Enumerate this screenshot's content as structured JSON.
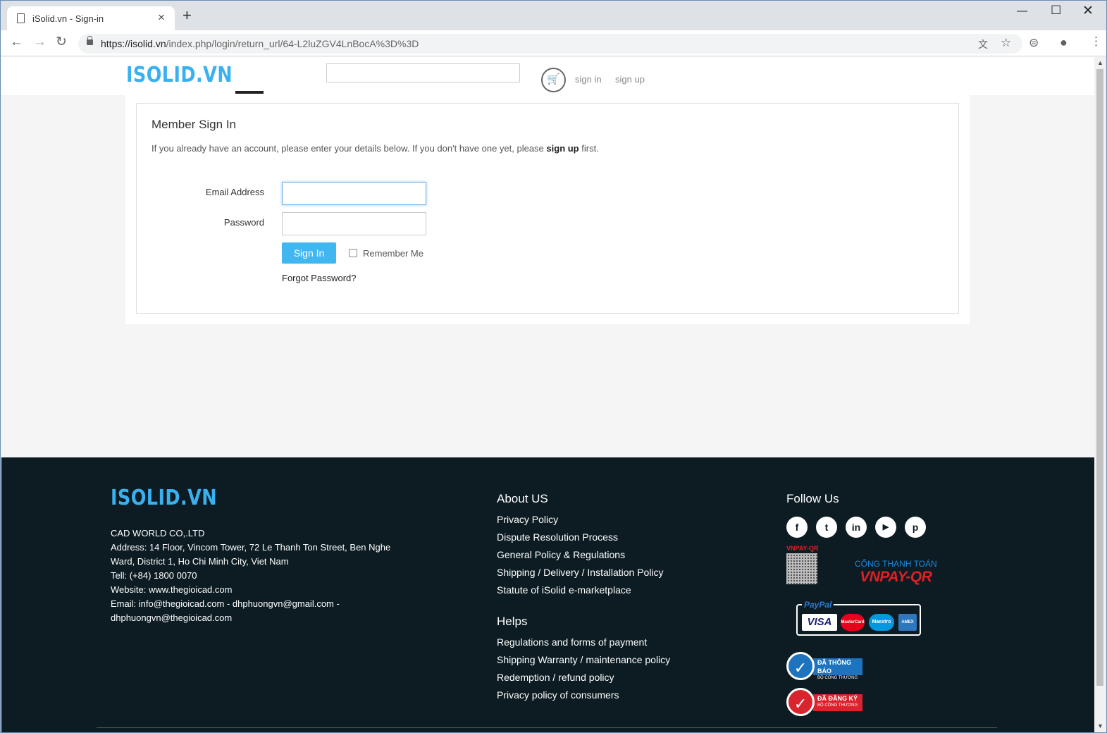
{
  "browser": {
    "tab_title": "iSolid.vn - Sign-in",
    "url_host": "https://isolid.vn",
    "url_path": "/index.php/login/return_url/64-L2luZGV4LnBocA%3D%3D"
  },
  "header": {
    "logo": "ISOLID.VN",
    "search_placeholder": "",
    "sign_in": "sign in",
    "sign_up": "sign up"
  },
  "login": {
    "title": "Member Sign In",
    "desc_pre": "If you already have an account, please enter your details below. If you don't have one yet, please ",
    "desc_link": "sign up",
    "desc_post": " first.",
    "email_label": "Email Address",
    "email_value": "",
    "password_label": "Password",
    "password_value": "",
    "signin_button": "Sign In",
    "remember_label": "Remember Me",
    "remember_checked": false,
    "forgot": "Forgot Password?"
  },
  "footer": {
    "logo": "ISOLID.VN",
    "company_lines": [
      "CAD WORLD CO,.LTD",
      "Address: 14 Floor, Vincom Tower, 72 Le Thanh Ton Street, Ben Nghe Ward, District 1, Ho Chi Minh City, Viet Nam",
      "Tell: (+84) 1800 0070",
      "Website: www.thegioicad.com",
      "Email: info@thegioicad.com - dhphuongvn@gmail.com - dhphuongvn@thegioicad.com"
    ],
    "about_title": "About US",
    "about_links": [
      "Privacy Policy",
      "Dispute Resolution Process",
      "General Policy & Regulations",
      "Shipping / Delivery / Installation Policy",
      "Statute of iSolid e-marketplace"
    ],
    "helps_title": "Helps",
    "helps_links": [
      "Regulations and forms of payment",
      "Shipping Warranty / maintenance policy",
      "Redemption / refund policy",
      "Privacy policy of consumers"
    ],
    "follow_title": "Follow Us",
    "social_icons": [
      "facebook-icon",
      "twitter-icon",
      "linkedin-icon",
      "youtube-icon",
      "pinterest-icon"
    ],
    "vnpay_qr_label": "VNPAY-QR",
    "vnpay_small": "CỔNG THANH TOÁN",
    "vnpay_big": "VNPAY-QR",
    "paypal_label": "PayPal",
    "cards": [
      "VISA",
      "MasterCard",
      "Maestro",
      "AMEX"
    ],
    "badge1_text": "ĐÃ THÔNG BÁO",
    "badge1_sub": "BỘ CÔNG THƯƠNG",
    "badge2_text": "ĐÃ ĐĂNG KÝ",
    "badge2_sub": "BỘ CÔNG THƯƠNG"
  },
  "colors": {
    "accent": "#41b7f2",
    "footer_bg": "#0c1c22",
    "badge1": "#1e73be",
    "badge2": "#d9232d"
  }
}
